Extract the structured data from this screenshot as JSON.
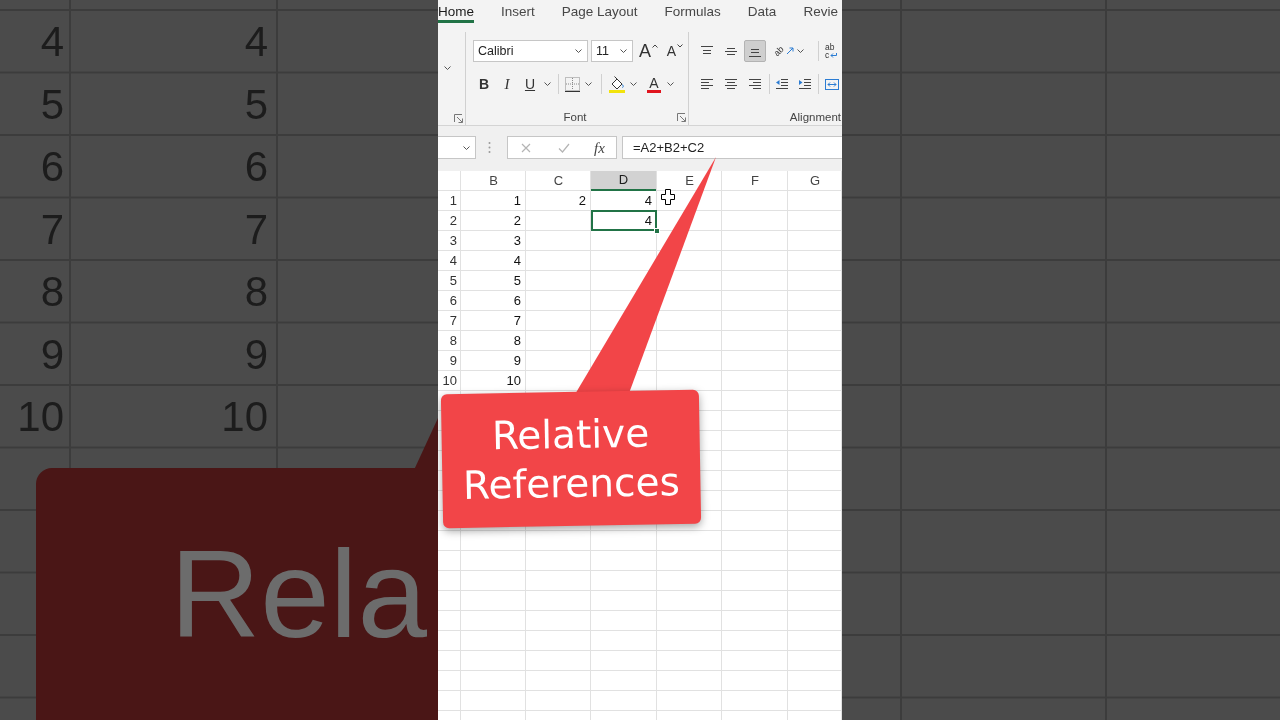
{
  "backdrop": {
    "rows": [
      {
        "header": "4",
        "value": "4"
      },
      {
        "header": "5",
        "value": "5"
      },
      {
        "header": "6",
        "value": "6"
      },
      {
        "header": "7",
        "value": "7"
      },
      {
        "header": "8",
        "value": "8"
      },
      {
        "header": "9",
        "value": "9"
      },
      {
        "header": "10",
        "value": "10"
      }
    ],
    "callout_text": "Rela"
  },
  "ribbon": {
    "tabs": [
      {
        "label": "Home",
        "selected": true
      },
      {
        "label": "Insert",
        "selected": false
      },
      {
        "label": "Page Layout",
        "selected": false
      },
      {
        "label": "Formulas",
        "selected": false
      },
      {
        "label": "Data",
        "selected": false
      },
      {
        "label": "Revie",
        "selected": false
      }
    ],
    "font_group": {
      "font_name": "Calibri",
      "font_size": "11",
      "grow_font": "A",
      "shrink_font": "A",
      "bold": "B",
      "italic": "I",
      "underline": "U",
      "font_color": "A",
      "label": "Font"
    },
    "alignment_group": {
      "vertical_align": [
        {
          "selected": false
        },
        {
          "selected": false
        },
        {
          "selected": true
        }
      ],
      "orientation": "ab",
      "horizontal_align": [
        {
          "selected": false
        },
        {
          "selected": false
        },
        {
          "selected": false
        }
      ],
      "wrap_text": [
        "ab",
        "c"
      ],
      "label": "Alignment"
    }
  },
  "formula_bar": {
    "cancel": {
      "disabled": true
    },
    "enter": {
      "disabled": true
    },
    "function_button": "fx",
    "formula": "=A2+B2+C2"
  },
  "sheet": {
    "columns": [
      {
        "label": "B",
        "selected": false
      },
      {
        "label": "C",
        "selected": false
      },
      {
        "label": "D",
        "selected": true
      },
      {
        "label": "E",
        "selected": false
      },
      {
        "label": "F",
        "selected": false
      },
      {
        "label": "G",
        "selected": false
      }
    ],
    "rows": [
      {
        "header": "1",
        "cells": [
          {
            "value": "1",
            "selected": false
          },
          {
            "value": "2",
            "selected": false
          },
          {
            "value": "4",
            "selected": false
          }
        ]
      },
      {
        "header": "2",
        "cells": [
          {
            "value": "2",
            "selected": false
          },
          null,
          {
            "value": "4",
            "selected": true
          }
        ]
      },
      {
        "header": "3",
        "cells": [
          {
            "value": "3",
            "selected": false
          }
        ]
      },
      {
        "header": "4",
        "cells": [
          {
            "value": "4",
            "selected": false
          }
        ]
      },
      {
        "header": "5",
        "cells": [
          {
            "value": "5",
            "selected": false
          }
        ]
      },
      {
        "header": "6",
        "cells": [
          {
            "value": "6",
            "selected": false
          }
        ]
      },
      {
        "header": "7",
        "cells": [
          {
            "value": "7",
            "selected": false
          }
        ]
      },
      {
        "header": "8",
        "cells": [
          {
            "value": "8",
            "selected": false
          }
        ]
      },
      {
        "header": "9",
        "cells": [
          {
            "value": "9",
            "selected": false
          }
        ]
      },
      {
        "header": "10",
        "cells": [
          {
            "value": "10",
            "selected": false
          }
        ]
      }
    ]
  },
  "callout": {
    "text": "Relative References"
  }
}
